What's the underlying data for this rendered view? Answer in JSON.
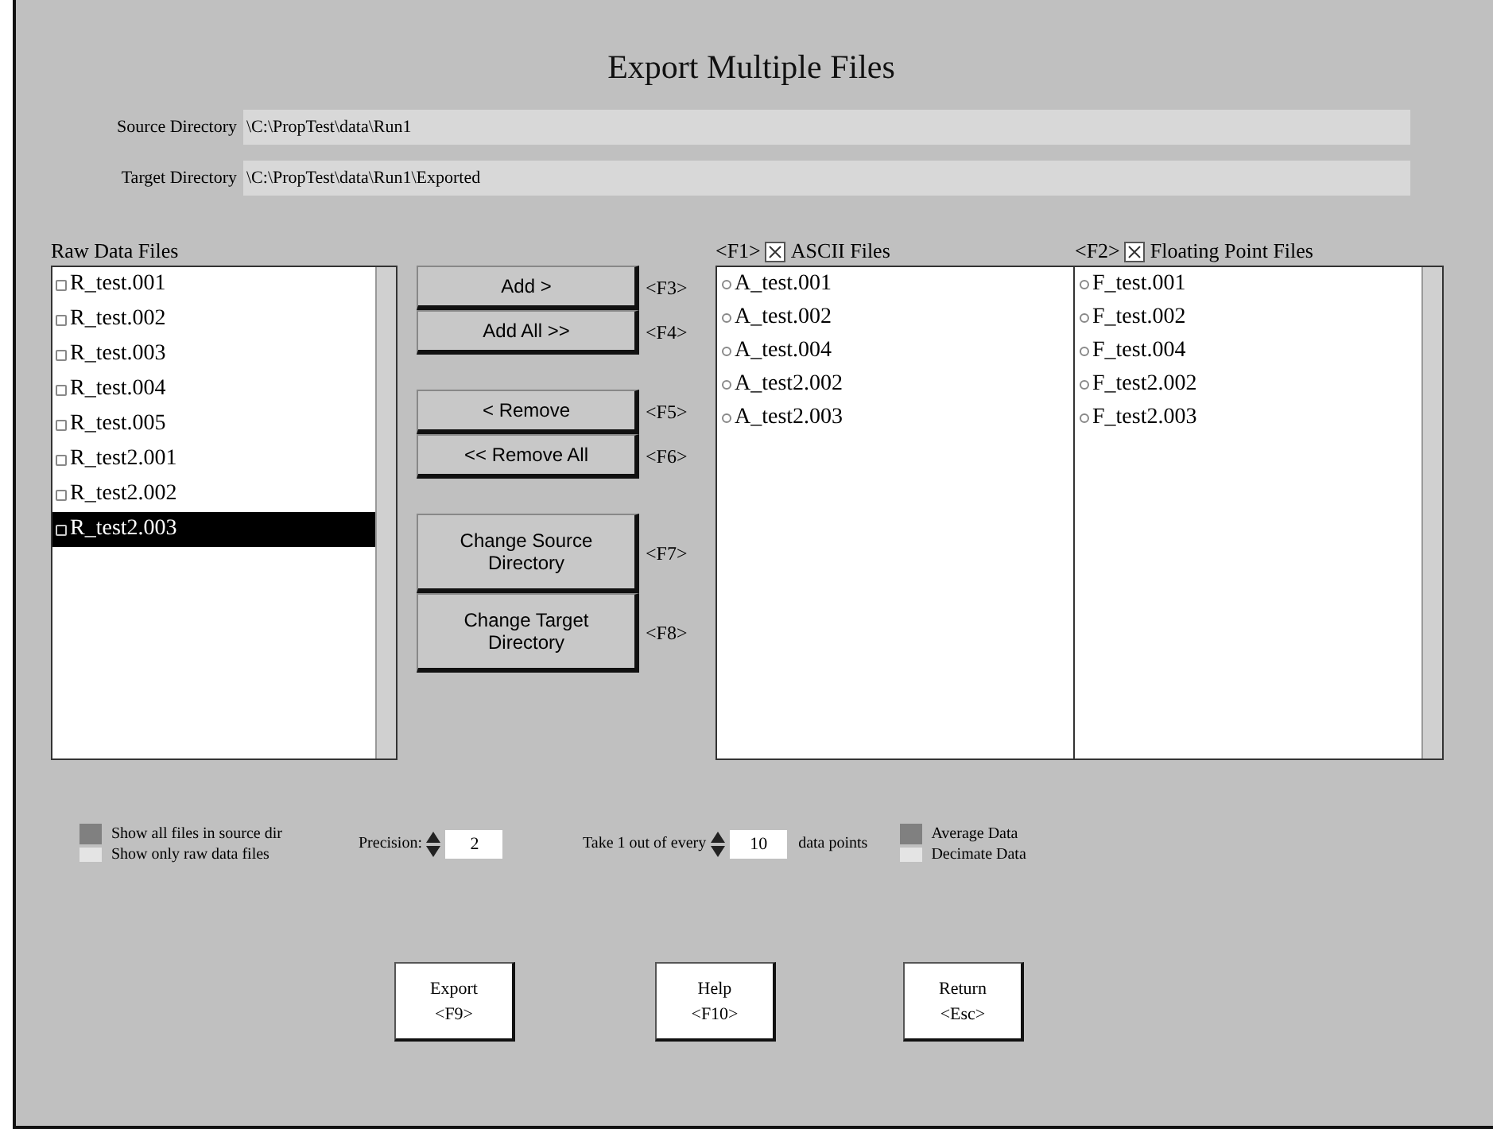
{
  "window": {
    "title": "Export Multiple Files"
  },
  "directories": [
    {
      "label": "Source Directory",
      "value": "\\C:\\PropTest\\data\\Run1"
    },
    {
      "label": "Target Directory",
      "value": "\\C:\\PropTest\\data\\Run1\\Exported"
    }
  ],
  "raw_files": {
    "title": "Raw Data Files",
    "items": [
      {
        "name": "R_test.001",
        "selected": false
      },
      {
        "name": "R_test.002",
        "selected": false
      },
      {
        "name": "R_test.003",
        "selected": false
      },
      {
        "name": "R_test.004",
        "selected": false
      },
      {
        "name": "R_test.005",
        "selected": false
      },
      {
        "name": "R_test2.001",
        "selected": false
      },
      {
        "name": "R_test2.002",
        "selected": false
      },
      {
        "name": "R_test2.003",
        "selected": true
      }
    ]
  },
  "action_groups": [
    [
      {
        "label": "Add >",
        "key": "<F3>"
      },
      {
        "label": "Add All >>",
        "key": "<F4>"
      }
    ],
    [
      {
        "label": "< Remove",
        "key": "<F5>"
      },
      {
        "label": "<< Remove All",
        "key": "<F6>"
      }
    ],
    [
      {
        "label": "Change Source Directory",
        "key": "<F7>"
      },
      {
        "label": "Change Target Directory",
        "key": "<F8>"
      }
    ]
  ],
  "output_lists": [
    {
      "key": "<F1>",
      "title": "ASCII Files",
      "checked": true,
      "items": [
        "A_test.001",
        "A_test.002",
        "A_test.004",
        "A_test2.002",
        "A_test2.003"
      ]
    },
    {
      "key": "<F2>",
      "title": "Floating Point Files",
      "checked": true,
      "items": [
        "F_test.001",
        "F_test.002",
        "F_test.004",
        "F_test2.002",
        "F_test2.003"
      ]
    }
  ],
  "file_filter": [
    {
      "label": "Show all files in source dir",
      "selected": true
    },
    {
      "label": "Show only raw data files",
      "selected": false
    }
  ],
  "precision": {
    "label": "Precision:",
    "value": "2"
  },
  "sampling": {
    "label": "Take 1 out of every",
    "value": "10",
    "suffix": "data points"
  },
  "data_mode": [
    {
      "label": "Average Data",
      "selected": true
    },
    {
      "label": "Decimate Data",
      "selected": false
    }
  ],
  "buttons": [
    {
      "label": "Export",
      "key": "<F9>"
    },
    {
      "label": "Help",
      "key": "<F10>"
    },
    {
      "label": "Return",
      "key": "<Esc>"
    }
  ]
}
